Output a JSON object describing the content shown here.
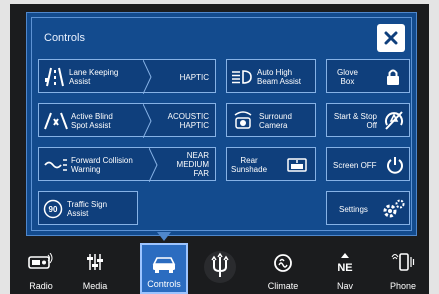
{
  "panel": {
    "title": "Controls",
    "close_label": "close"
  },
  "tiles": {
    "lane_keeping": {
      "label": "Lane Keeping\nAssist",
      "value": "HAPTIC"
    },
    "active_blind_spot": {
      "label": "Active Blind\nSpot Assist",
      "value": "ACOUSTIC\nHAPTIC"
    },
    "forward_collision": {
      "label": "Forward Collision\nWarning",
      "value": "NEAR\nMEDIUM\nFAR"
    },
    "traffic_sign": {
      "label": "Traffic Sign\nAssist"
    },
    "auto_high_beam": {
      "label": "Auto High\nBeam Assist"
    },
    "surround_camera": {
      "label": "Surround\nCamera"
    },
    "rear_sunshade": {
      "label": "Rear\nSunshade"
    },
    "glove_box": {
      "label": "Glove\nBox"
    },
    "start_stop": {
      "label": "Start & Stop\nOff"
    },
    "screen_off": {
      "label": "Screen OFF"
    },
    "settings": {
      "label": "Settings"
    }
  },
  "nav": [
    {
      "label": "Radio",
      "icon": "radio-icon"
    },
    {
      "label": "Media",
      "icon": "media-icon"
    },
    {
      "label": "Controls",
      "icon": "car-icon",
      "active": true
    },
    {
      "label": "",
      "icon": "trident-logo-icon"
    },
    {
      "label": "Climate",
      "icon": "climate-icon"
    },
    {
      "label": "Nav",
      "icon": "compass-icon"
    },
    {
      "label": "Phone",
      "icon": "phone-icon"
    }
  ],
  "colors": {
    "panel_bg": "#134b8e",
    "tile_border": "#86b2e6",
    "nav_active": "#2b6cc0"
  }
}
